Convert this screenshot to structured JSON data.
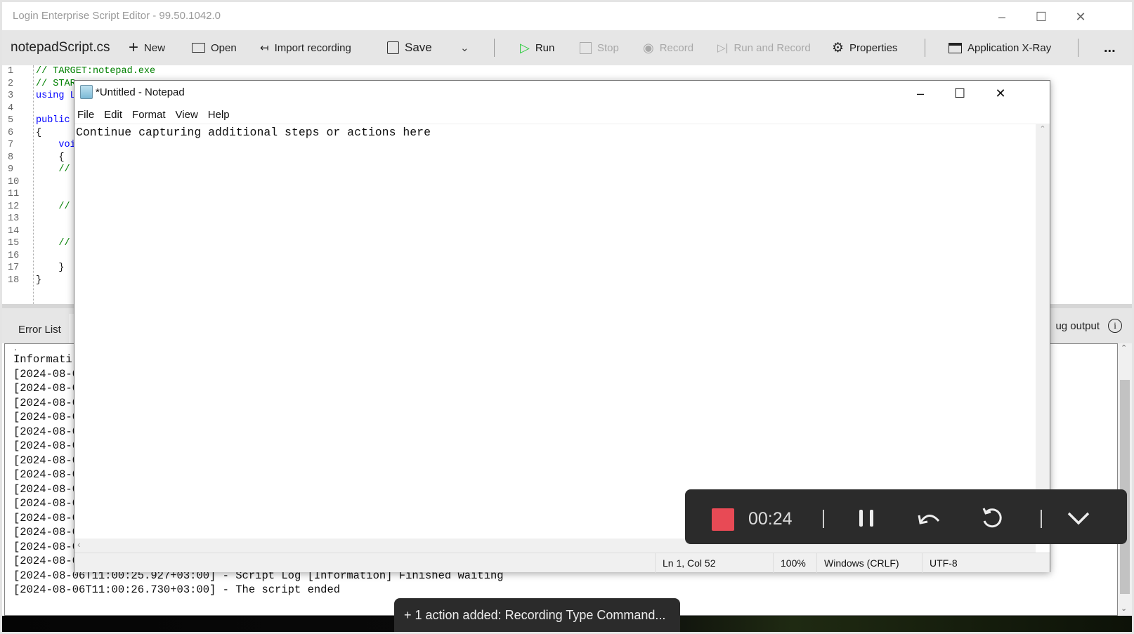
{
  "window": {
    "title": "Login Enterprise Script Editor - 99.50.1042.0"
  },
  "toolbar": {
    "filename": "notepadScript.cs",
    "new": "New",
    "open": "Open",
    "import": "Import recording",
    "save": "Save",
    "run": "Run",
    "stop": "Stop",
    "record": "Record",
    "run_and_record": "Run and Record",
    "properties": "Properties",
    "xray": "Application X-Ray",
    "more": "..."
  },
  "editor": {
    "lines": [
      {
        "n": "1",
        "text": "// TARGET:notepad.exe",
        "kind": "comment"
      },
      {
        "n": "2",
        "text": "// STAR",
        "kind": "comment"
      },
      {
        "n": "3",
        "text": "using L",
        "kind": "keyword"
      },
      {
        "n": "4",
        "text": "",
        "kind": "plain"
      },
      {
        "n": "5",
        "text": "public",
        "kind": "keyword"
      },
      {
        "n": "6",
        "text": "{",
        "kind": "plain"
      },
      {
        "n": "7",
        "text": "    voi",
        "kind": "keyword"
      },
      {
        "n": "8",
        "text": "    {",
        "kind": "plain"
      },
      {
        "n": "9",
        "text": "    //",
        "kind": "comment"
      },
      {
        "n": "10",
        "text": "",
        "kind": "plain"
      },
      {
        "n": "11",
        "text": "",
        "kind": "plain"
      },
      {
        "n": "12",
        "text": "    //",
        "kind": "comment"
      },
      {
        "n": "13",
        "text": "",
        "kind": "plain"
      },
      {
        "n": "14",
        "text": "",
        "kind": "plain"
      },
      {
        "n": "15",
        "text": "    //",
        "kind": "comment"
      },
      {
        "n": "16",
        "text": "",
        "kind": "plain"
      },
      {
        "n": "17",
        "text": "    }",
        "kind": "plain"
      },
      {
        "n": "18",
        "text": "}",
        "kind": "plain"
      }
    ]
  },
  "panel": {
    "tab_error_list": "Error List",
    "tab_debug_output": "ug output",
    "log_lines": [
      "Informati",
      "[2024-08-0",
      "[2024-08-0",
      "[2024-08-0",
      "[2024-08-0",
      "[2024-08-0",
      "[2024-08-0",
      "[2024-08-0",
      "[2024-08-0",
      "[2024-08-0",
      "[2024-08-0",
      "[2024-08-0",
      "[2024-08-0",
      "[2024-08-0",
      "[2024-08-0",
      "[2024-08-06T11:00:25.927+03:00] - Script Log [Information] Finished waiting",
      "[2024-08-06T11:00:26.730+03:00] - The script ended"
    ]
  },
  "notepad": {
    "title": "*Untitled - Notepad",
    "menu": [
      "File",
      "Edit",
      "Format",
      "View",
      "Help"
    ],
    "content": "Continue capturing additional steps or actions here",
    "status": {
      "position": "Ln 1, Col 52",
      "zoom": "100%",
      "line_ending": "Windows (CRLF)",
      "encoding": "UTF-8"
    }
  },
  "recorder": {
    "elapsed": "00:24",
    "stop_color": "#e84a55"
  },
  "toast": {
    "text": "+ 1 action added: Recording Type Command..."
  },
  "colors": {
    "comment": "#008000",
    "keyword": "#0000ff",
    "run_icon": "#2ecc40"
  }
}
